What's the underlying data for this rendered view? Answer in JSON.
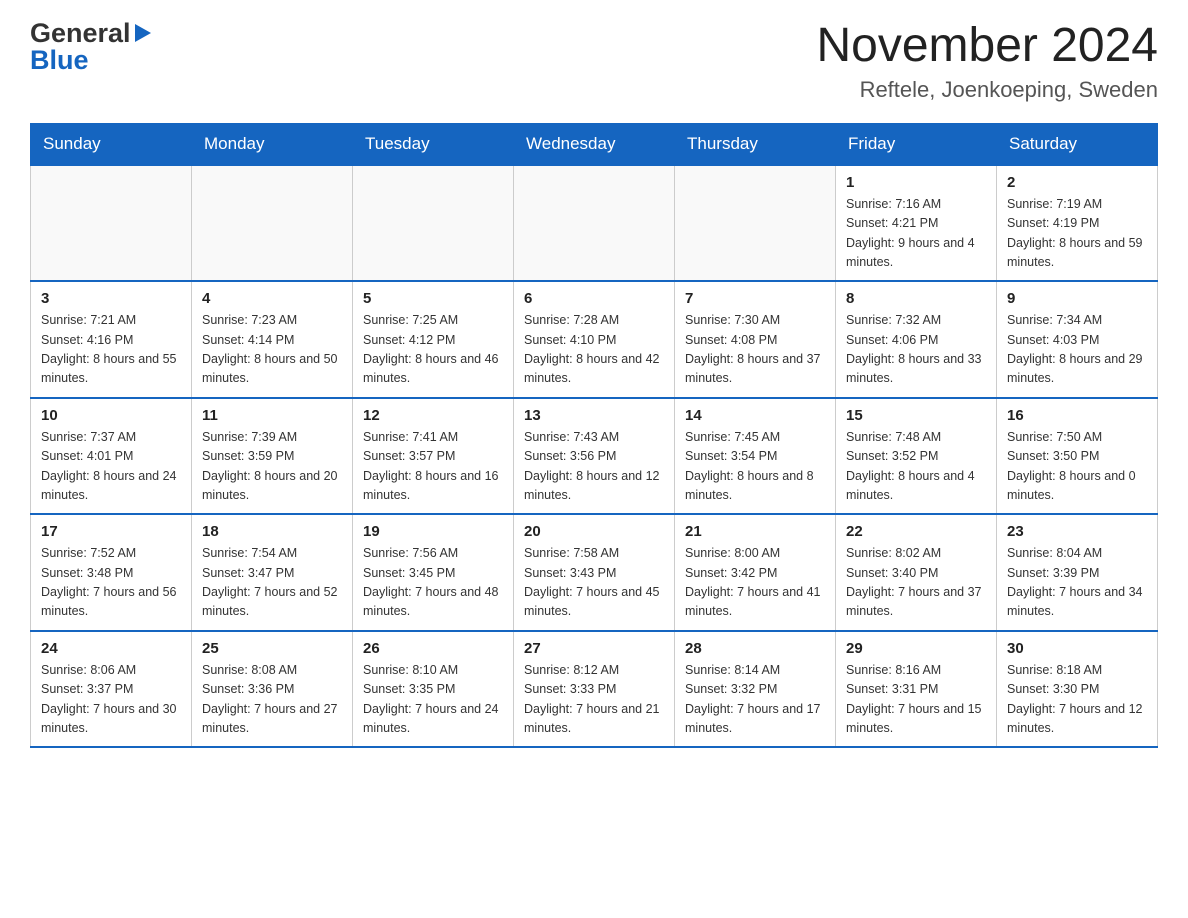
{
  "logo": {
    "general": "General",
    "blue": "Blue",
    "arrow": "▶"
  },
  "header": {
    "month": "November 2024",
    "location": "Reftele, Joenkoeping, Sweden"
  },
  "weekdays": [
    "Sunday",
    "Monday",
    "Tuesday",
    "Wednesday",
    "Thursday",
    "Friday",
    "Saturday"
  ],
  "weeks": [
    [
      {
        "day": "",
        "info": ""
      },
      {
        "day": "",
        "info": ""
      },
      {
        "day": "",
        "info": ""
      },
      {
        "day": "",
        "info": ""
      },
      {
        "day": "",
        "info": ""
      },
      {
        "day": "1",
        "info": "Sunrise: 7:16 AM\nSunset: 4:21 PM\nDaylight: 9 hours\nand 4 minutes."
      },
      {
        "day": "2",
        "info": "Sunrise: 7:19 AM\nSunset: 4:19 PM\nDaylight: 8 hours\nand 59 minutes."
      }
    ],
    [
      {
        "day": "3",
        "info": "Sunrise: 7:21 AM\nSunset: 4:16 PM\nDaylight: 8 hours\nand 55 minutes."
      },
      {
        "day": "4",
        "info": "Sunrise: 7:23 AM\nSunset: 4:14 PM\nDaylight: 8 hours\nand 50 minutes."
      },
      {
        "day": "5",
        "info": "Sunrise: 7:25 AM\nSunset: 4:12 PM\nDaylight: 8 hours\nand 46 minutes."
      },
      {
        "day": "6",
        "info": "Sunrise: 7:28 AM\nSunset: 4:10 PM\nDaylight: 8 hours\nand 42 minutes."
      },
      {
        "day": "7",
        "info": "Sunrise: 7:30 AM\nSunset: 4:08 PM\nDaylight: 8 hours\nand 37 minutes."
      },
      {
        "day": "8",
        "info": "Sunrise: 7:32 AM\nSunset: 4:06 PM\nDaylight: 8 hours\nand 33 minutes."
      },
      {
        "day": "9",
        "info": "Sunrise: 7:34 AM\nSunset: 4:03 PM\nDaylight: 8 hours\nand 29 minutes."
      }
    ],
    [
      {
        "day": "10",
        "info": "Sunrise: 7:37 AM\nSunset: 4:01 PM\nDaylight: 8 hours\nand 24 minutes."
      },
      {
        "day": "11",
        "info": "Sunrise: 7:39 AM\nSunset: 3:59 PM\nDaylight: 8 hours\nand 20 minutes."
      },
      {
        "day": "12",
        "info": "Sunrise: 7:41 AM\nSunset: 3:57 PM\nDaylight: 8 hours\nand 16 minutes."
      },
      {
        "day": "13",
        "info": "Sunrise: 7:43 AM\nSunset: 3:56 PM\nDaylight: 8 hours\nand 12 minutes."
      },
      {
        "day": "14",
        "info": "Sunrise: 7:45 AM\nSunset: 3:54 PM\nDaylight: 8 hours\nand 8 minutes."
      },
      {
        "day": "15",
        "info": "Sunrise: 7:48 AM\nSunset: 3:52 PM\nDaylight: 8 hours\nand 4 minutes."
      },
      {
        "day": "16",
        "info": "Sunrise: 7:50 AM\nSunset: 3:50 PM\nDaylight: 8 hours\nand 0 minutes."
      }
    ],
    [
      {
        "day": "17",
        "info": "Sunrise: 7:52 AM\nSunset: 3:48 PM\nDaylight: 7 hours\nand 56 minutes."
      },
      {
        "day": "18",
        "info": "Sunrise: 7:54 AM\nSunset: 3:47 PM\nDaylight: 7 hours\nand 52 minutes."
      },
      {
        "day": "19",
        "info": "Sunrise: 7:56 AM\nSunset: 3:45 PM\nDaylight: 7 hours\nand 48 minutes."
      },
      {
        "day": "20",
        "info": "Sunrise: 7:58 AM\nSunset: 3:43 PM\nDaylight: 7 hours\nand 45 minutes."
      },
      {
        "day": "21",
        "info": "Sunrise: 8:00 AM\nSunset: 3:42 PM\nDaylight: 7 hours\nand 41 minutes."
      },
      {
        "day": "22",
        "info": "Sunrise: 8:02 AM\nSunset: 3:40 PM\nDaylight: 7 hours\nand 37 minutes."
      },
      {
        "day": "23",
        "info": "Sunrise: 8:04 AM\nSunset: 3:39 PM\nDaylight: 7 hours\nand 34 minutes."
      }
    ],
    [
      {
        "day": "24",
        "info": "Sunrise: 8:06 AM\nSunset: 3:37 PM\nDaylight: 7 hours\nand 30 minutes."
      },
      {
        "day": "25",
        "info": "Sunrise: 8:08 AM\nSunset: 3:36 PM\nDaylight: 7 hours\nand 27 minutes."
      },
      {
        "day": "26",
        "info": "Sunrise: 8:10 AM\nSunset: 3:35 PM\nDaylight: 7 hours\nand 24 minutes."
      },
      {
        "day": "27",
        "info": "Sunrise: 8:12 AM\nSunset: 3:33 PM\nDaylight: 7 hours\nand 21 minutes."
      },
      {
        "day": "28",
        "info": "Sunrise: 8:14 AM\nSunset: 3:32 PM\nDaylight: 7 hours\nand 17 minutes."
      },
      {
        "day": "29",
        "info": "Sunrise: 8:16 AM\nSunset: 3:31 PM\nDaylight: 7 hours\nand 15 minutes."
      },
      {
        "day": "30",
        "info": "Sunrise: 8:18 AM\nSunset: 3:30 PM\nDaylight: 7 hours\nand 12 minutes."
      }
    ]
  ],
  "colors": {
    "header_bg": "#1565c0",
    "header_text": "#ffffff",
    "border": "#1565c0",
    "cell_border": "#cccccc"
  }
}
